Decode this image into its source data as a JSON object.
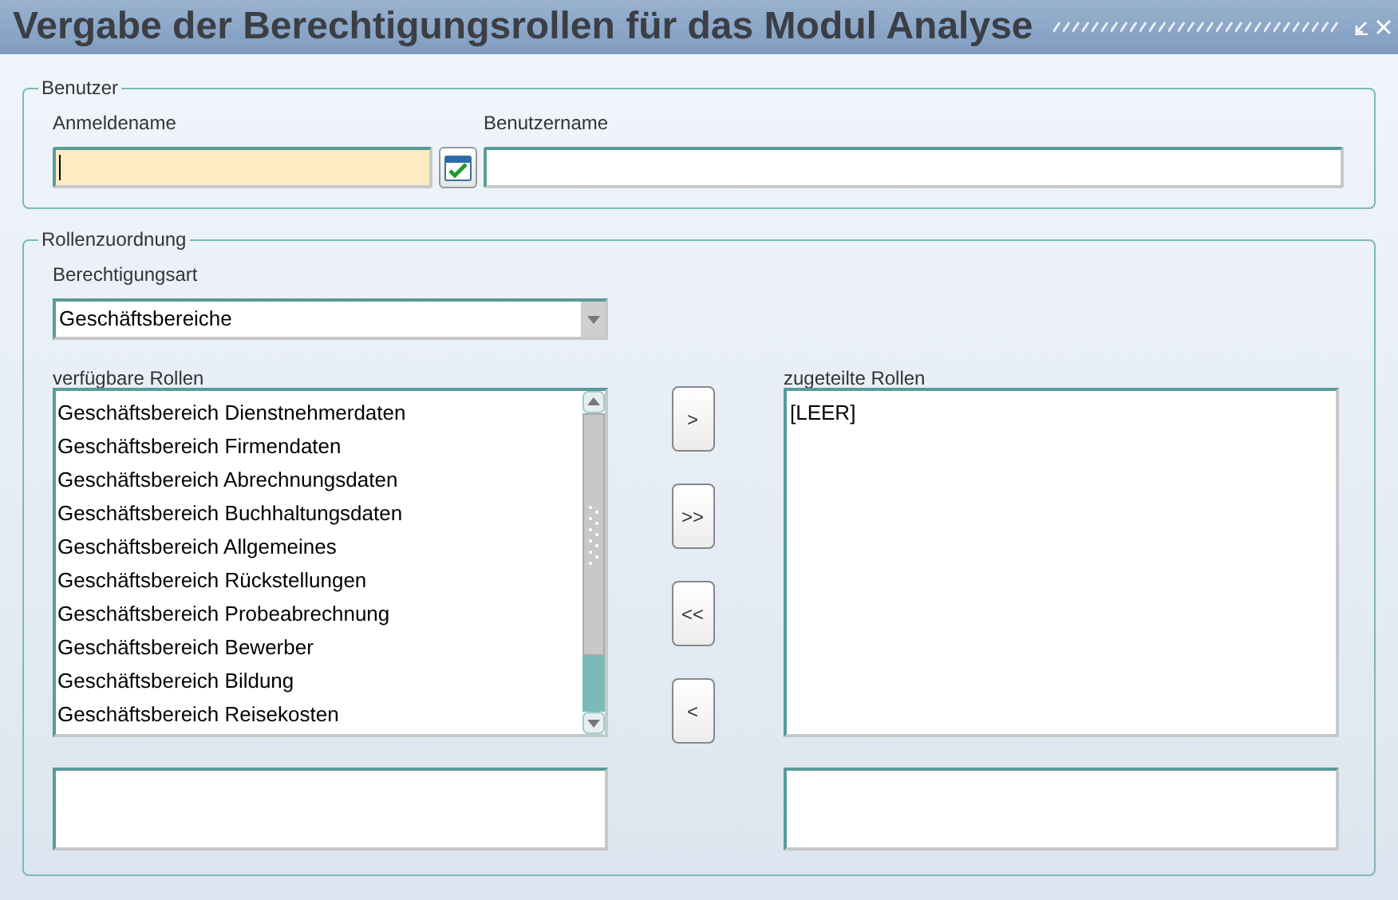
{
  "window": {
    "title": "Vergabe der Berechtigungsrollen für das Modul Analyse"
  },
  "user_group": {
    "label": "Benutzer",
    "login_name": {
      "label": "Anmeldename",
      "focused": true
    },
    "user_name": {
      "label": "Benutzername",
      "focused": false
    }
  },
  "roles_group": {
    "label": "Rollenzuordnung",
    "permission_type": {
      "label": "Berechtigungsart",
      "value": "Geschäftsbereiche"
    },
    "available_roles": {
      "label": "verfügbare Rollen",
      "items": [
        "Geschäftsbereich Dienstnehmerdaten",
        "Geschäftsbereich Firmendaten",
        "Geschäftsbereich Abrechnungsdaten",
        "Geschäftsbereich Buchhaltungsdaten",
        "Geschäftsbereich Allgemeines",
        "Geschäftsbereich Rückstellungen",
        "Geschäftsbereich Probeabrechnung",
        "Geschäftsbereich Bewerber",
        "Geschäftsbereich Bildung",
        "Geschäftsbereich Reisekosten"
      ]
    },
    "move_buttons": [
      ">",
      ">>",
      "<<",
      "<"
    ],
    "assigned_roles": {
      "label": "zugeteilte Rollen",
      "items": [
        "[LEER]"
      ]
    }
  }
}
